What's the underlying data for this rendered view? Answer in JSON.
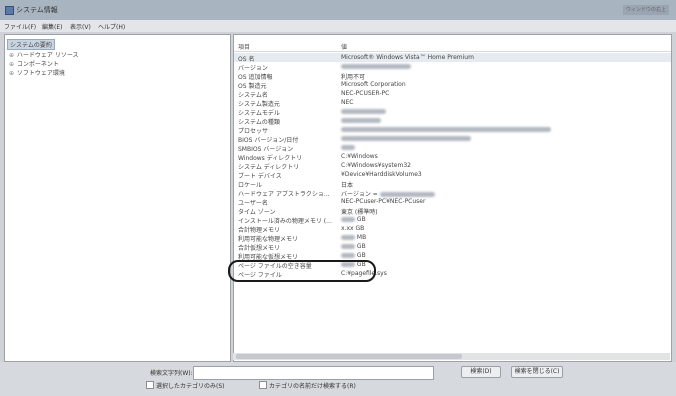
{
  "window": {
    "title": "システム情報",
    "right_text": "ウィンドウの右上"
  },
  "menu": [
    "ファイル(F)",
    "編集(E)",
    "表示(V)",
    "ヘルプ(H)"
  ],
  "tree": [
    {
      "label": "システムの要約",
      "expander": ""
    },
    {
      "label": "ハードウェア リソース",
      "expander": "⊕"
    },
    {
      "label": "コンポーネント",
      "expander": "⊕"
    },
    {
      "label": "ソフトウェア環境",
      "expander": "⊕"
    }
  ],
  "table": {
    "col_item": "項目",
    "col_value": "値",
    "rows": [
      {
        "item": "OS 名",
        "value": "Microsoft® Windows Vista™ Home Premium"
      },
      {
        "item": "バージョン",
        "value": ""
      },
      {
        "item": "OS 追加情報",
        "value": "利用不可"
      },
      {
        "item": "OS 製造元",
        "value": "Microsoft Corporation"
      },
      {
        "item": "システム名",
        "value": "NEC-PCUSER-PC"
      },
      {
        "item": "システム製造元",
        "value": "NEC"
      },
      {
        "item": "システムモデル",
        "value": ""
      },
      {
        "item": "システムの種類",
        "value": ""
      },
      {
        "item": "プロセッサ",
        "value": ""
      },
      {
        "item": "BIOS バージョン/日付",
        "value": ""
      },
      {
        "item": "SMBIOS バージョン",
        "value": ""
      },
      {
        "item": "Windows ディレクトリ",
        "value": "C:¥Windows"
      },
      {
        "item": "システム ディレクトリ",
        "value": "C:¥Windows¥system32"
      },
      {
        "item": "ブート デバイス",
        "value": "¥Device¥HarddiskVolume3"
      },
      {
        "item": "ロケール",
        "value": "日本"
      },
      {
        "item": "ハードウェア アブストラクショ...",
        "value": "バージョン ="
      },
      {
        "item": "ユーザー名",
        "value": "NEC-PCuser-PC¥NEC-PCuser"
      },
      {
        "item": "タイム ゾーン",
        "value": "東京 (標準時)"
      },
      {
        "item": "インストール済みの物理メモリ (...",
        "value": "GB"
      },
      {
        "item": "合計物理メモリ",
        "value": "x.xx GB"
      },
      {
        "item": "利用可能な物理メモリ",
        "value": "MB"
      },
      {
        "item": "合計仮想メモリ",
        "value": "GB"
      },
      {
        "item": "利用可能な仮想メモリ",
        "value": "GB"
      },
      {
        "item": "ページ ファイルの空き容量",
        "value": "GB"
      },
      {
        "item": "ページ ファイル",
        "value": "C:¥pagefile.sys"
      }
    ]
  },
  "search": {
    "label": "検索文字列(W):",
    "value": "",
    "find_button": "検索(D)",
    "close_find_button": "検索を閉じる(C)",
    "check_selected_only": "選択したカテゴリのみ(S)",
    "check_category_names": "カテゴリの名前だけ検索する(R)"
  }
}
